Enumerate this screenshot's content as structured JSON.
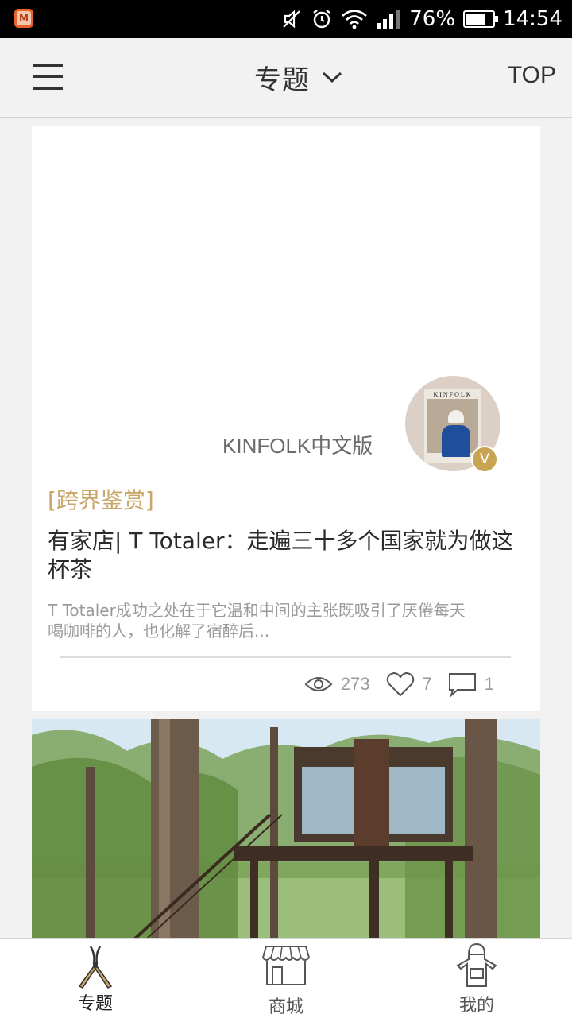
{
  "status_bar": {
    "battery_percent": "76%",
    "battery_level": 0.76,
    "time": "14:54",
    "icons": [
      "app-icon",
      "mute-icon",
      "alarm-icon",
      "wifi-icon",
      "signal-icon",
      "battery-icon"
    ]
  },
  "header": {
    "title": "专题",
    "top_label": "TOP",
    "menu_icon": "hamburger-icon",
    "dropdown_icon": "chevron-down-icon"
  },
  "article": {
    "author": "KINFOLK中文版",
    "avatar_cover_text": "KINFOLK",
    "verified_badge": "V",
    "category": "[跨界鉴赏]",
    "title": "有家店| T Totaler：走遍三十多个国家就为做这杯茶",
    "summary": "T Totaler成功之处在于它温和中间的主张既吸引了厌倦每天喝咖啡的人，也化解了宿醉后...",
    "views": "273",
    "likes": "7",
    "comments": "1"
  },
  "tabs": [
    {
      "label": "专题",
      "icon": "pruning-shears-icon",
      "active": true
    },
    {
      "label": "商城",
      "icon": "storefront-icon",
      "active": false
    },
    {
      "label": "我的",
      "icon": "apron-icon",
      "active": false
    }
  ],
  "colors": {
    "accent": "#c9a768",
    "badge": "#c8a352",
    "text_dark": "#2b2b2b",
    "text_muted": "#9a9a9a",
    "background": "#f1f1f1"
  }
}
